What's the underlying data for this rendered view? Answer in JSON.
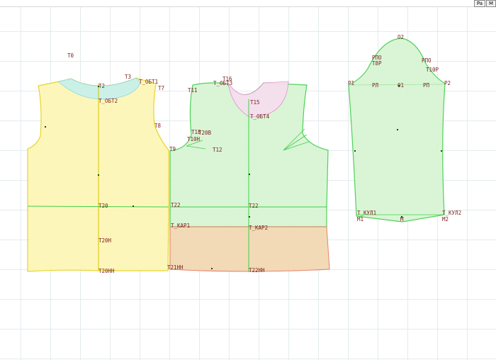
{
  "toolbar": {
    "btn_pa": "Pa",
    "btn_m": "M"
  },
  "colors": {
    "front_fill": "#fdf6b5",
    "front_stroke": "#e3d21f",
    "back_fill": "#d6f5d2",
    "back_stroke": "#3fcf4a",
    "yoke_fill": "#f2d9b3",
    "yoke_stroke": "#e67a6a",
    "facing_front_fill": "#c6f0ee",
    "facing_back_fill": "#f7ddf0",
    "label_color": "#7a1f1f"
  },
  "labels": {
    "t0": "Т0",
    "t3": "Т3",
    "t_obt1": "Т_ОБТ1",
    "t7": "Т7",
    "t2": "Т2",
    "t_obt2": "Т_ОБТ2",
    "t8": "Т8",
    "t20": "Т20",
    "t20n": "Т20Н",
    "t20nn": "Т20НН",
    "t16": "Т16",
    "t_obt3": "Т_ОБТ3",
    "t11": "Т11",
    "t15": "Т15",
    "t_obt4": "Т_ОБТ4",
    "t18": "Т18",
    "t20v": "Т20В",
    "t10n": "Т10Н",
    "t9": "Т9",
    "t12": "Т12",
    "t22": "Т22",
    "t_kar1": "Т_КАР1",
    "t_kar2": "Т_КАР2",
    "t22nn": "Т22НН",
    "t21nn": "Т21НН",
    "o2": "О2",
    "rpo_l": "РПО",
    "t8r": "Т8Р",
    "rpo_r": "РПО",
    "t10r": "Т10Р",
    "p1": "Р1",
    "rl": "РЛ",
    "o1": "О1",
    "rp": "РП",
    "p2": "Р2",
    "t_kul1": "Т_КУЛ1",
    "t_kul2": "Т_КУЛ2",
    "m1": "М1",
    "m": "М",
    "m2": "М2"
  }
}
